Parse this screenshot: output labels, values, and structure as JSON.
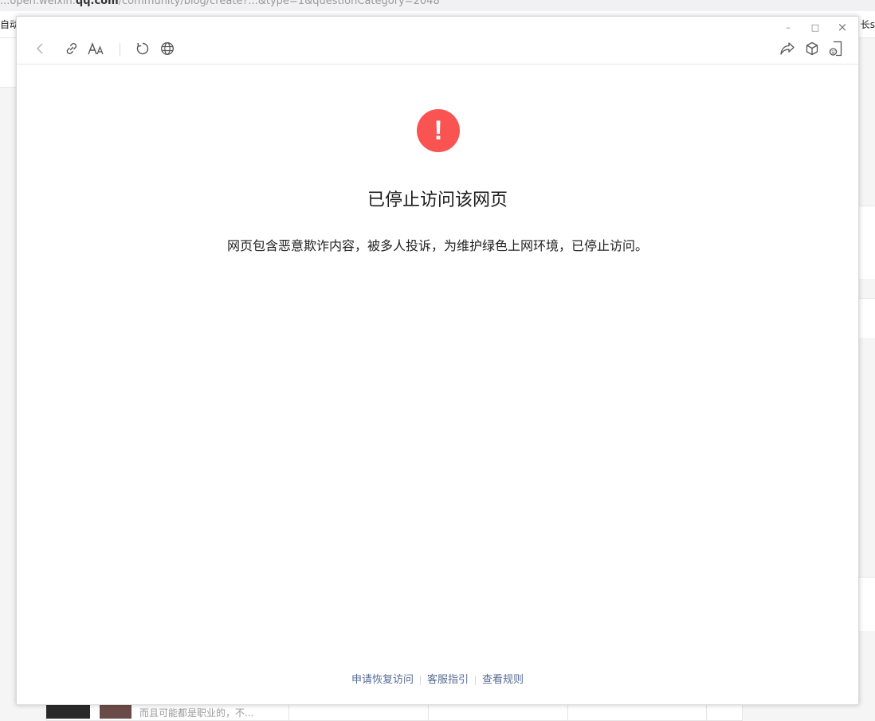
{
  "background": {
    "url_prefix": "...open.weixin.",
    "url_domain": "qq.com",
    "url_suffix": "/community/blog/create?...&type=1&questionCategory=2048",
    "bookmark_left": "自动",
    "bookmark_right": "长s",
    "snippet": "而且可能都是职业的，不..."
  },
  "window": {
    "minimize_glyph": "–",
    "maximize_glyph": "□",
    "close_glyph": "×"
  },
  "main": {
    "alert_glyph": "!",
    "title": "已停止访问该网页",
    "message": "网页包含恶意欺诈内容，被多人投诉，为维护绿色上网环境，已停止访问。"
  },
  "footer": {
    "links": [
      {
        "label": "申请恢复访问"
      },
      {
        "label": "客服指引"
      },
      {
        "label": "查看规则"
      }
    ]
  },
  "colors": {
    "alert": "#f95452",
    "link": "#576b95"
  }
}
